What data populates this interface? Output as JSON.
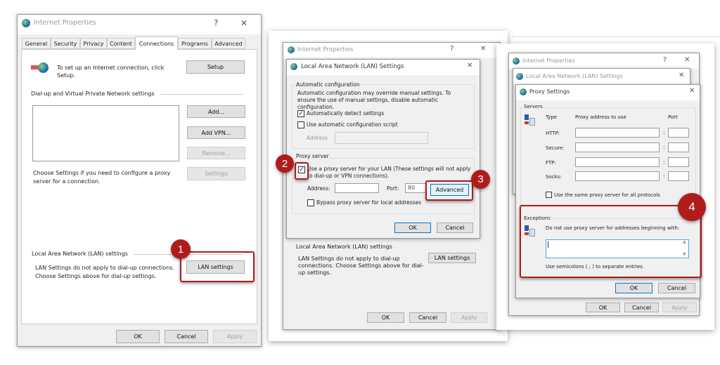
{
  "panel1": {
    "title": "Internet Properties",
    "help": "?",
    "close": "✕",
    "tabs": [
      "General",
      "Security",
      "Privacy",
      "Content",
      "Connections",
      "Programs",
      "Advanced"
    ],
    "active_tab": "Connections",
    "setup_text": "To set up an Internet connection, click Setup.",
    "setup": "Setup",
    "dialup_group": "Dial-up and Virtual Private Network settings",
    "add": "Add...",
    "add_vpn": "Add VPN...",
    "remove": "Remove...",
    "settings": "Settings",
    "choose_text": "Choose Settings if you need to configure a proxy server for a connection.",
    "lan_group": "Local Area Network (LAN) settings",
    "lan_text": "LAN Settings do not apply to dial-up connections. Choose Settings above for dial-up settings.",
    "lan_settings": "LAN settings",
    "ok": "OK",
    "cancel": "Cancel",
    "apply": "Apply",
    "step": "1"
  },
  "panel2": {
    "bg_title": "Internet Properties",
    "help": "?",
    "close": "✕",
    "title": "Local Area Network (LAN) Settings",
    "auto_group": "Automatic configuration",
    "auto_text": "Automatic configuration may override manual settings.  To ensure the use of manual settings, disable automatic configuration.",
    "auto_detect": "Automatically detect settings",
    "auto_detect_checked": true,
    "use_script": "Use automatic configuration script",
    "use_script_checked": false,
    "address_label": "Address",
    "address_value": "",
    "proxy_group": "Proxy server",
    "use_proxy": "Use a proxy server for your LAN (These settings will not apply to dial-up or VPN connections).",
    "use_proxy_checked": true,
    "proxy_address_label": "Address:",
    "proxy_address": "",
    "port_label": "Port:",
    "port": "80",
    "advanced": "Advanced",
    "bypass": "Bypass proxy server for local addresses",
    "bypass_checked": false,
    "ok": "OK",
    "cancel": "Cancel",
    "bg_lan_group": "Local Area Network (LAN) settings",
    "bg_lan_text": "LAN Settings do not apply to dial-up connections. Choose Settings above for dial-up settings.",
    "bg_lan_settings": "LAN settings",
    "bg_ok": "OK",
    "bg_cancel": "Cancel",
    "bg_apply": "Apply",
    "step2": "2",
    "step3": "3"
  },
  "panel3": {
    "bg_title": "Internet Properties",
    "bg_lan_title": "Local Area Network (LAN) Settings",
    "help": "?",
    "close": "✕",
    "title": "Proxy Settings",
    "servers": "Servers",
    "col_type": "Type",
    "col_address": "Proxy address to use",
    "col_port": "Port",
    "rows": [
      {
        "type": "HTTP:",
        "address": "",
        "port": ""
      },
      {
        "type": "Secure:",
        "address": "",
        "port": ""
      },
      {
        "type": "FTP:",
        "address": "",
        "port": ""
      },
      {
        "type": "Socks:",
        "address": "",
        "port": ""
      }
    ],
    "colon": ":",
    "same_proxy": "Use the same proxy server for all protocols",
    "same_proxy_checked": false,
    "exceptions": "Exceptions",
    "exceptions_text": "Do not use proxy server for addresses beginning with:",
    "exceptions_value": "",
    "semicolon_note": "Use semicolons ( ; ) to separate entries.",
    "ok": "OK",
    "cancel": "Cancel",
    "bg_ok": "OK",
    "bg_cancel": "Cancel",
    "bg_apply": "Apply",
    "step": "4"
  },
  "colors": {
    "highlight": "#b01c1c",
    "default_button": "#0078d7"
  }
}
